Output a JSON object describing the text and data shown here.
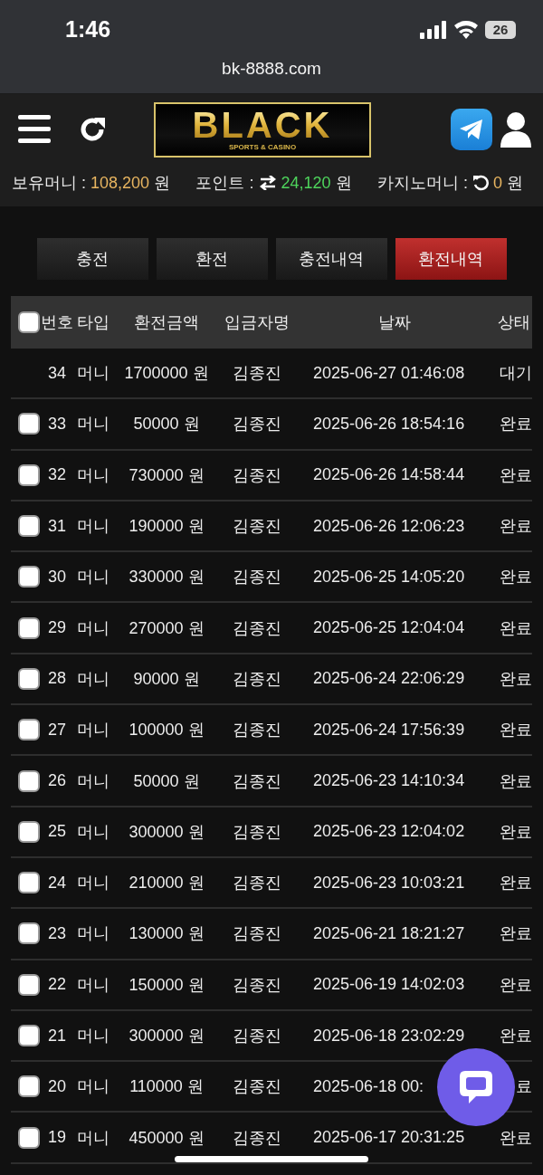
{
  "status_bar": {
    "time": "1:46",
    "battery": "26"
  },
  "browser": {
    "url": "bk-8888.com"
  },
  "logo": {
    "title": "BLACK",
    "subtitle": "SPORTS & CASINO"
  },
  "balances": [
    {
      "kind": "money",
      "label": "보유머니 :",
      "value": "108,200",
      "unit": "원",
      "color": "#e8b560"
    },
    {
      "kind": "transfer",
      "label": "포인트 :",
      "value": "24,120",
      "unit": "원",
      "color": "#4ed45c"
    },
    {
      "kind": "reload",
      "label": "카지노머니 :",
      "value": "0",
      "unit": "원",
      "color": "#e8b560"
    }
  ],
  "tabs": [
    {
      "label": "충전",
      "selected": false
    },
    {
      "label": "환전",
      "selected": false
    },
    {
      "label": "충전내역",
      "selected": false
    },
    {
      "label": "환전내역",
      "selected": true
    }
  ],
  "table": {
    "header_checked": false,
    "columns": [
      "번호",
      "타입",
      "환전금액",
      "입금자명",
      "날짜",
      "상태"
    ],
    "rows": [
      {
        "cells": [
          "34",
          "머니",
          "1700000 원",
          "김종진",
          "2025-06-27 01:46:08",
          "대기"
        ]
      },
      {
        "checked": false,
        "cells": [
          "33",
          "머니",
          "50000 원",
          "김종진",
          "2025-06-26 18:54:16",
          "완료"
        ]
      },
      {
        "checked": false,
        "cells": [
          "32",
          "머니",
          "730000 원",
          "김종진",
          "2025-06-26 14:58:44",
          "완료"
        ]
      },
      {
        "checked": false,
        "cells": [
          "31",
          "머니",
          "190000 원",
          "김종진",
          "2025-06-26 12:06:23",
          "완료"
        ]
      },
      {
        "checked": false,
        "cells": [
          "30",
          "머니",
          "330000 원",
          "김종진",
          "2025-06-25 14:05:20",
          "완료"
        ]
      },
      {
        "checked": false,
        "cells": [
          "29",
          "머니",
          "270000 원",
          "김종진",
          "2025-06-25 12:04:04",
          "완료"
        ]
      },
      {
        "checked": false,
        "cells": [
          "28",
          "머니",
          "90000 원",
          "김종진",
          "2025-06-24 22:06:29",
          "완료"
        ]
      },
      {
        "checked": false,
        "cells": [
          "27",
          "머니",
          "100000 원",
          "김종진",
          "2025-06-24 17:56:39",
          "완료"
        ]
      },
      {
        "checked": false,
        "cells": [
          "26",
          "머니",
          "50000 원",
          "김종진",
          "2025-06-23 14:10:34",
          "완료"
        ]
      },
      {
        "checked": false,
        "cells": [
          "25",
          "머니",
          "300000 원",
          "김종진",
          "2025-06-23 12:04:02",
          "완료"
        ]
      },
      {
        "checked": false,
        "cells": [
          "24",
          "머니",
          "210000 원",
          "김종진",
          "2025-06-23 10:03:21",
          "완료"
        ]
      },
      {
        "checked": false,
        "cells": [
          "23",
          "머니",
          "130000 원",
          "김종진",
          "2025-06-21 18:21:27",
          "완료"
        ]
      },
      {
        "checked": false,
        "cells": [
          "22",
          "머니",
          "150000 원",
          "김종진",
          "2025-06-19 14:02:03",
          "완료"
        ]
      },
      {
        "checked": false,
        "cells": [
          "21",
          "머니",
          "300000 원",
          "김종진",
          "2025-06-18 23:02:29",
          "완료"
        ]
      },
      {
        "checked": false,
        "cells": [
          "20",
          "머니",
          "110000 원",
          "김종진",
          "2025-06-18 00:",
          "료"
        ]
      },
      {
        "checked": false,
        "cells": [
          "19",
          "머니",
          "450000 원",
          "김종진",
          "2025-06-17 20:31:25",
          "완료"
        ]
      }
    ]
  }
}
